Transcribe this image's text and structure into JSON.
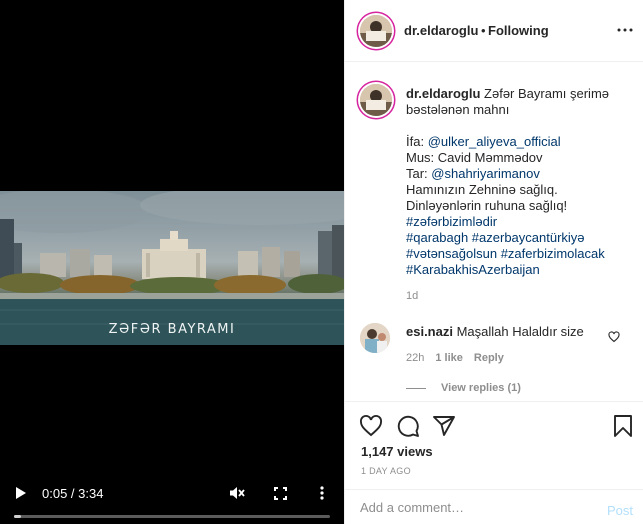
{
  "video": {
    "overlay_caption": "ZƏFƏR BAYRAMI",
    "time_label": "0:05 / 3:34",
    "progress_fraction": 0.0234,
    "icons": {
      "play": "play-icon",
      "mute": "volume-muted-icon",
      "fullscreen": "fullscreen-icon",
      "more": "more-vertical-icon"
    }
  },
  "header": {
    "username": "dr.eldaroglu",
    "separator": "•",
    "follow_status": "Following",
    "more_icon": "more-horizontal-icon"
  },
  "caption": {
    "username": "dr.eldaroglu",
    "first_line": "Zəfər Bayramı şerimə",
    "second_line": "bəstələnən mahnı",
    "ifa_prefix": "İfa: ",
    "ifa_handle": "@ulker_aliyeva_official",
    "mus": "Mus: Cavid Məmmədov",
    "tar_prefix": "Tar: ",
    "tar_handle": "@shahriyarimanov",
    "wish1": "Hamınızın Zehninə sağlıq.",
    "wish2": "Dinləyənlərin ruhuna sağlıq!",
    "tag1": "#zəfərbizimlədir",
    "tag2": "#qarabagh",
    "tag3": "#azerbaycantürkiyə",
    "tag4": "#vətənsağolsun",
    "tag5": "#zaferbizimolacak",
    "tag6": "#KarabakhisAzerbaijan",
    "age": "1d"
  },
  "comment": {
    "username": "esi.nazi",
    "text": "Maşallah Halaldır size",
    "age": "22h",
    "likes": "1 like",
    "reply": "Reply",
    "view_replies": "View replies (1)"
  },
  "actions": {
    "icons": [
      "heart-icon",
      "comment-icon",
      "share-icon",
      "bookmark-icon"
    ],
    "views": "1,147 views",
    "date": "1 DAY AGO"
  },
  "add_comment": {
    "placeholder": "Add a comment…",
    "post_label": "Post",
    "post_color": "#b2dffc"
  },
  "colors": {
    "link": "#00376b",
    "muted": "#8e8e8e",
    "text": "#262626",
    "story_ring": "#d6249f"
  }
}
